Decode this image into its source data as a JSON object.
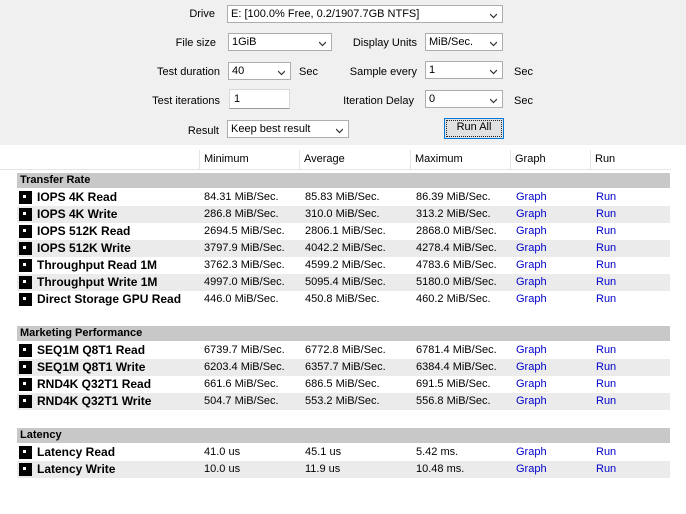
{
  "controls": {
    "drive": {
      "label": "Drive",
      "value": "E: [100.0% Free, 0.2/1907.7GB NTFS]"
    },
    "file_size": {
      "label": "File size",
      "value": "1GiB"
    },
    "display_units": {
      "label": "Display Units",
      "value": "MiB/Sec."
    },
    "test_duration": {
      "label": "Test duration",
      "value": "40",
      "unit": "Sec"
    },
    "sample_every": {
      "label": "Sample every",
      "value": "1",
      "unit": "Sec"
    },
    "test_iterations": {
      "label": "Test iterations",
      "value": "1"
    },
    "iteration_delay": {
      "label": "Iteration Delay",
      "value": "0",
      "unit": "Sec"
    },
    "result": {
      "label": "Result",
      "value": "Keep best result"
    },
    "run_all_label": "Run All"
  },
  "columns": [
    "Minimum",
    "Average",
    "Maximum",
    "Graph",
    "Run"
  ],
  "sections": [
    {
      "title": "Transfer Rate",
      "rows": [
        {
          "name": "IOPS 4K Read",
          "min": "84.31 MiB/Sec.",
          "avg": "85.83 MiB/Sec.",
          "max": "86.39 MiB/Sec.",
          "graph": "Graph",
          "run": "Run"
        },
        {
          "name": "IOPS 4K Write",
          "min": "286.8 MiB/Sec.",
          "avg": "310.0 MiB/Sec.",
          "max": "313.2 MiB/Sec.",
          "graph": "Graph",
          "run": "Run"
        },
        {
          "name": "IOPS 512K Read",
          "min": "2694.5 MiB/Sec.",
          "avg": "2806.1 MiB/Sec.",
          "max": "2868.0 MiB/Sec.",
          "graph": "Graph",
          "run": "Run"
        },
        {
          "name": "IOPS 512K Write",
          "min": "3797.9 MiB/Sec.",
          "avg": "4042.2 MiB/Sec.",
          "max": "4278.4 MiB/Sec.",
          "graph": "Graph",
          "run": "Run"
        },
        {
          "name": "Throughput Read 1M",
          "min": "3762.3 MiB/Sec.",
          "avg": "4599.2 MiB/Sec.",
          "max": "4783.6 MiB/Sec.",
          "graph": "Graph",
          "run": "Run"
        },
        {
          "name": "Throughput Write 1M",
          "min": "4997.0 MiB/Sec.",
          "avg": "5095.4 MiB/Sec.",
          "max": "5180.0 MiB/Sec.",
          "graph": "Graph",
          "run": "Run"
        },
        {
          "name": "Direct Storage GPU Read",
          "min": "446.0 MiB/Sec.",
          "avg": "450.8 MiB/Sec.",
          "max": "460.2 MiB/Sec.",
          "graph": "Graph",
          "run": "Run"
        }
      ]
    },
    {
      "title": "Marketing Performance",
      "rows": [
        {
          "name": "SEQ1M Q8T1 Read",
          "min": "6739.7 MiB/Sec.",
          "avg": "6772.8 MiB/Sec.",
          "max": "6781.4 MiB/Sec.",
          "graph": "Graph",
          "run": "Run"
        },
        {
          "name": "SEQ1M Q8T1 Write",
          "min": "6203.4 MiB/Sec.",
          "avg": "6357.7 MiB/Sec.",
          "max": "6384.4 MiB/Sec.",
          "graph": "Graph",
          "run": "Run"
        },
        {
          "name": "RND4K Q32T1 Read",
          "min": "661.6 MiB/Sec.",
          "avg": "686.5 MiB/Sec.",
          "max": "691.5 MiB/Sec.",
          "graph": "Graph",
          "run": "Run"
        },
        {
          "name": "RND4K Q32T1 Write",
          "min": "504.7 MiB/Sec.",
          "avg": "553.2 MiB/Sec.",
          "max": "556.8 MiB/Sec.",
          "graph": "Graph",
          "run": "Run"
        }
      ]
    },
    {
      "title": "Latency",
      "rows": [
        {
          "name": "Latency Read",
          "min": "41.0 us",
          "avg": "45.1 us",
          "max": "5.42 ms.",
          "graph": "Graph",
          "run": "Run"
        },
        {
          "name": "Latency Write",
          "min": "10.0 us",
          "avg": "11.9 us",
          "max": "10.48 ms.",
          "graph": "Graph",
          "run": "Run"
        }
      ]
    }
  ]
}
